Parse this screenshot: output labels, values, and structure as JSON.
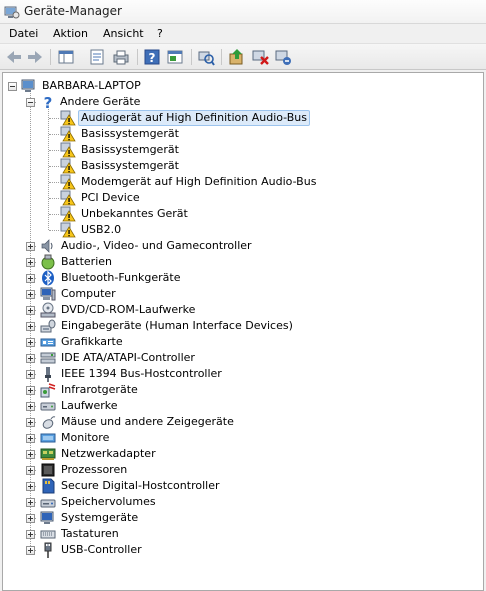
{
  "window": {
    "title": "Geräte-Manager"
  },
  "menu": [
    "Datei",
    "Aktion",
    "Ansicht",
    "?"
  ],
  "toolbar": {
    "buttons": [
      "back-icon",
      "forward-icon",
      "show-tree-icon",
      "properties-icon",
      "print-icon",
      "help-icon",
      "action-pane-icon",
      "scan-hardware-icon",
      "update-driver-icon",
      "disable-device-icon",
      "uninstall-device-icon"
    ]
  },
  "tree": {
    "root": "BARBARA-LAPTOP",
    "other_devices": {
      "label": "Andere Geräte",
      "children": [
        "Audiogerät auf High Definition Audio-Bus",
        "Basissystemgerät",
        "Basissystemgerät",
        "Basissystemgerät",
        "Modemgerät auf High Definition Audio-Bus",
        "PCI Device",
        "Unbekanntes Gerät",
        "USB2.0"
      ],
      "selected": "Audiogerät auf High Definition Audio-Bus"
    },
    "categories": [
      {
        "label": "Audio-, Video- und Gamecontroller",
        "icon": "speaker-icon"
      },
      {
        "label": "Batterien",
        "icon": "battery-icon"
      },
      {
        "label": "Bluetooth-Funkgeräte",
        "icon": "bluetooth-icon"
      },
      {
        "label": "Computer",
        "icon": "computer-icon"
      },
      {
        "label": "DVD/CD-ROM-Laufwerke",
        "icon": "dvd-drive-icon"
      },
      {
        "label": "Eingabegeräte (Human Interface Devices)",
        "icon": "hid-icon"
      },
      {
        "label": "Grafikkarte",
        "icon": "display-adapter-icon"
      },
      {
        "label": "IDE ATA/ATAPI-Controller",
        "icon": "ide-controller-icon"
      },
      {
        "label": "IEEE 1394 Bus-Hostcontroller",
        "icon": "firewire-icon"
      },
      {
        "label": "Infrarotgeräte",
        "icon": "infrared-icon"
      },
      {
        "label": "Laufwerke",
        "icon": "disk-drive-icon"
      },
      {
        "label": "Mäuse und andere Zeigegeräte",
        "icon": "mouse-icon"
      },
      {
        "label": "Monitore",
        "icon": "monitor-icon"
      },
      {
        "label": "Netzwerkadapter",
        "icon": "network-adapter-icon"
      },
      {
        "label": "Prozessoren",
        "icon": "processor-icon"
      },
      {
        "label": "Secure Digital-Hostcontroller",
        "icon": "sd-host-icon"
      },
      {
        "label": "Speichervolumes",
        "icon": "storage-volume-icon"
      },
      {
        "label": "Systemgeräte",
        "icon": "system-devices-icon"
      },
      {
        "label": "Tastaturen",
        "icon": "keyboard-icon"
      },
      {
        "label": "USB-Controller",
        "icon": "usb-icon"
      }
    ]
  }
}
